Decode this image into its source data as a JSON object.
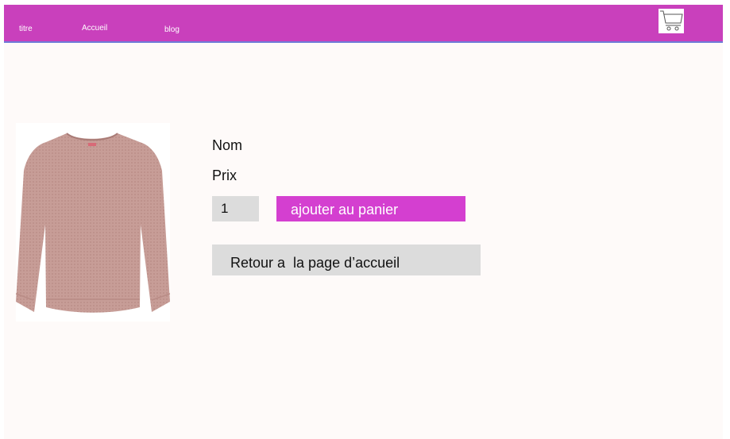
{
  "nav": {
    "titre": "titre",
    "accueil": "Accueil",
    "blog": "blog",
    "cart_icon": "shopping-cart-icon"
  },
  "product": {
    "image_icon": "sweater-image",
    "name": "Nom",
    "price": "Prix",
    "quantity": "1",
    "add_to_cart_label": "ajouter au panier",
    "back_label": "Retour a  la page d’accueil"
  },
  "colors": {
    "navbar": "#c940bc",
    "add_button": "#d43fd0",
    "field_gray": "#dcdcdc",
    "page_background": "#fefaf9"
  }
}
